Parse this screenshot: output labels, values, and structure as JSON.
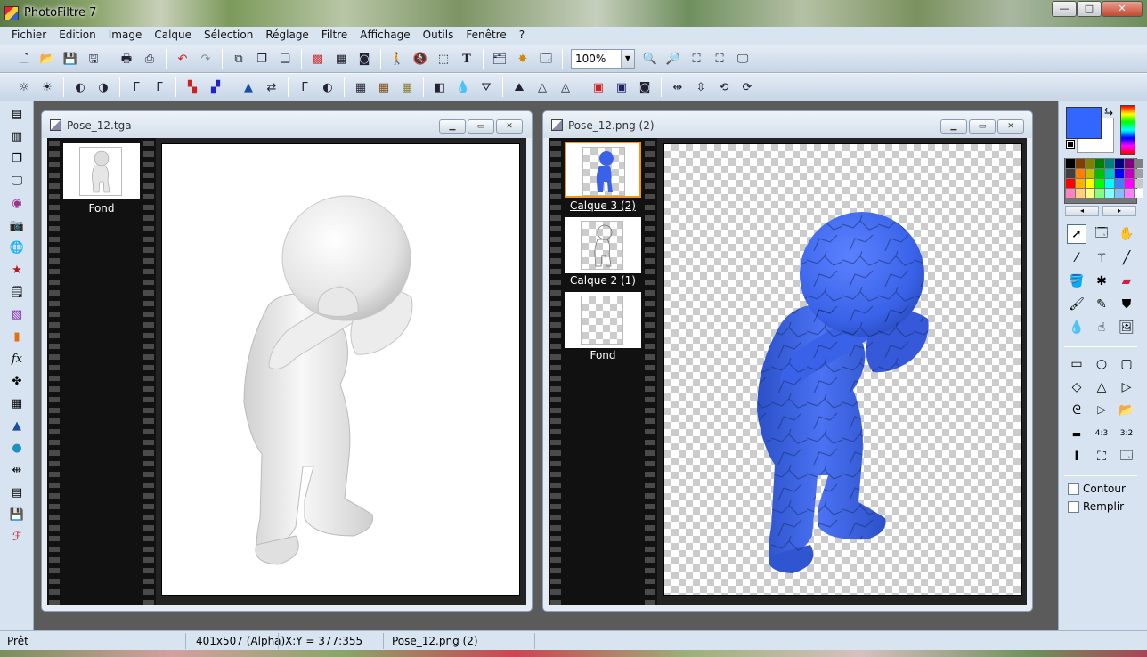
{
  "app": {
    "title": "PhotoFiltre 7"
  },
  "window_buttons": {
    "minimize": "—",
    "maximize": "□",
    "close": "✕"
  },
  "menu": [
    "Fichier",
    "Edition",
    "Image",
    "Calque",
    "Sélection",
    "Réglage",
    "Filtre",
    "Affichage",
    "Outils",
    "Fenêtre",
    "?"
  ],
  "toolbar": {
    "zoom_value": "100%"
  },
  "documents": [
    {
      "title": "Pose_12.tga",
      "layers": [
        {
          "label": "Fond",
          "selected": false
        }
      ]
    },
    {
      "title": "Pose_12.png (2)",
      "layers": [
        {
          "label": "Calque 3 (2)",
          "selected": true
        },
        {
          "label": "Calque 2 (1)",
          "selected": false
        },
        {
          "label": "Fond",
          "selected": false
        }
      ]
    }
  ],
  "colors": {
    "foreground": "#3366ff",
    "background": "#ffffff",
    "selection_border": "#f29a17"
  },
  "right_panel": {
    "contour_label": "Contour",
    "remplir_label": "Remplir"
  },
  "status": {
    "state": "Prêt",
    "dimensions": "401x507 (Alpha)",
    "coords": "X:Y = 377:355",
    "filename": "Pose_12.png (2)"
  }
}
